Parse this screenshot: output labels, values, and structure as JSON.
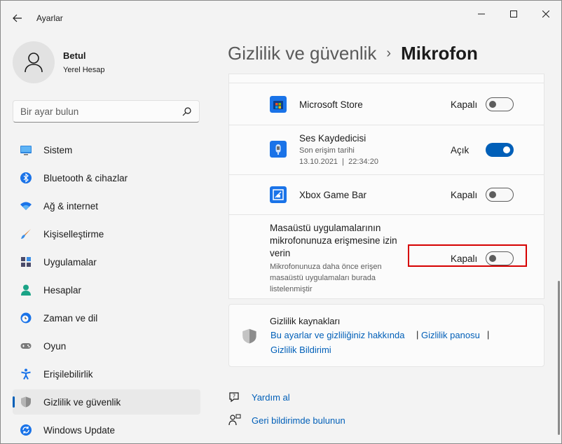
{
  "window": {
    "title": "Ayarlar"
  },
  "profile": {
    "name": "Betul",
    "account_type": "Yerel Hesap"
  },
  "search": {
    "placeholder": "Bir ayar bulun"
  },
  "nav": {
    "items": [
      {
        "label": "Sistem",
        "icon": "monitor-icon"
      },
      {
        "label": "Bluetooth & cihazlar",
        "icon": "bluetooth-icon"
      },
      {
        "label": "Ağ & internet",
        "icon": "wifi-icon"
      },
      {
        "label": "Kişiselleştirme",
        "icon": "brush-icon"
      },
      {
        "label": "Uygulamalar",
        "icon": "apps-icon"
      },
      {
        "label": "Hesaplar",
        "icon": "person-icon"
      },
      {
        "label": "Zaman ve dil",
        "icon": "clock-globe-icon"
      },
      {
        "label": "Oyun",
        "icon": "gamepad-icon"
      },
      {
        "label": "Erişilebilirlik",
        "icon": "accessibility-icon"
      },
      {
        "label": "Gizlilik ve güvenlik",
        "icon": "shield-icon",
        "selected": true
      },
      {
        "label": "Windows Update",
        "icon": "update-icon"
      }
    ]
  },
  "breadcrumb": {
    "parent": "Gizlilik ve güvenlik",
    "separator": "›",
    "current": "Mikrofon"
  },
  "apps": [
    {
      "name": "Microsoft Store",
      "state": "Kapalı",
      "on": false,
      "icon": "microsoft-store-icon"
    },
    {
      "name": "Ses Kaydedicisi",
      "sub1": "Son erişim tarihi",
      "sub2": "13.10.2021  |  22:34:20",
      "state": "Açık",
      "on": true,
      "icon": "voice-recorder-icon"
    },
    {
      "name": "Xbox Game Bar",
      "state": "Kapalı",
      "on": false,
      "icon": "xbox-game-bar-icon"
    }
  ],
  "desktop_apps": {
    "title": "Masaüstü uygulamalarının mikrofonunuza erişmesine izin verin",
    "description": "Mikrofonunuza daha önce erişen masaüstü uygulamaları burada listelenmiştir",
    "state": "Kapalı",
    "on": false
  },
  "privacy_resources": {
    "title": "Gizlilik kaynakları",
    "link1": "Bu ayarlar ve gizliliğiniz hakkında",
    "link2": "Gizlilik panosu",
    "link3": "Gizlilik Bildirimi",
    "pipe": "|"
  },
  "footer": {
    "help": "Yardım al",
    "feedback": "Geri bildirimde bulunun"
  },
  "colors": {
    "accent": "#005fb8",
    "highlight": "#d60000"
  }
}
